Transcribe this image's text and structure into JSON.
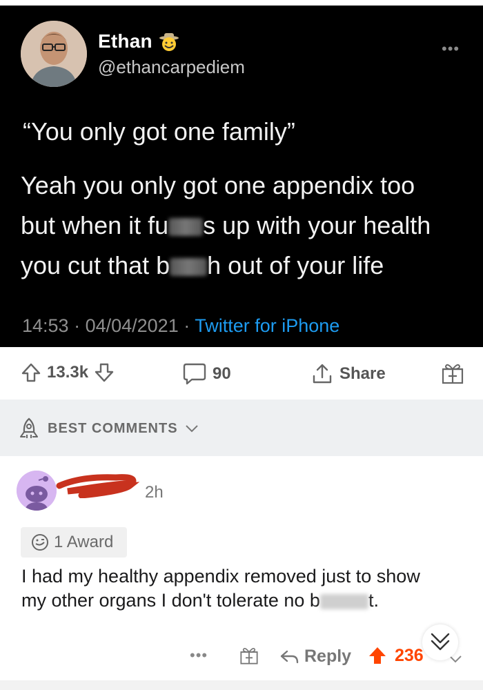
{
  "tweet": {
    "name": "Ethan",
    "handle": "@ethancarpediem",
    "quote": "“You only got one family”",
    "line1": "Yeah you only got one appendix too",
    "line2_a": "but when it fu",
    "line2_b": "s up with your health",
    "line3_a": "you cut that b",
    "line3_b": "h out of your life",
    "time": "14:53",
    "date": "04/04/2021",
    "source": "Twitter for iPhone",
    "more_icon": "more-dots-icon"
  },
  "actions": {
    "votes": "13.3k",
    "comments": "90",
    "share": "Share"
  },
  "comments_header": {
    "label": "BEST COMMENTS"
  },
  "comment": {
    "time": "2h",
    "award": "1 Award",
    "text_a": "I had my healthy appendix removed just to show my other organs I don't tolerate no",
    "text_b": "b",
    "text_c": "t.",
    "reply": "Reply",
    "score": "236"
  },
  "colors": {
    "upvote": "#ff4500",
    "link": "#1d9bf0"
  }
}
